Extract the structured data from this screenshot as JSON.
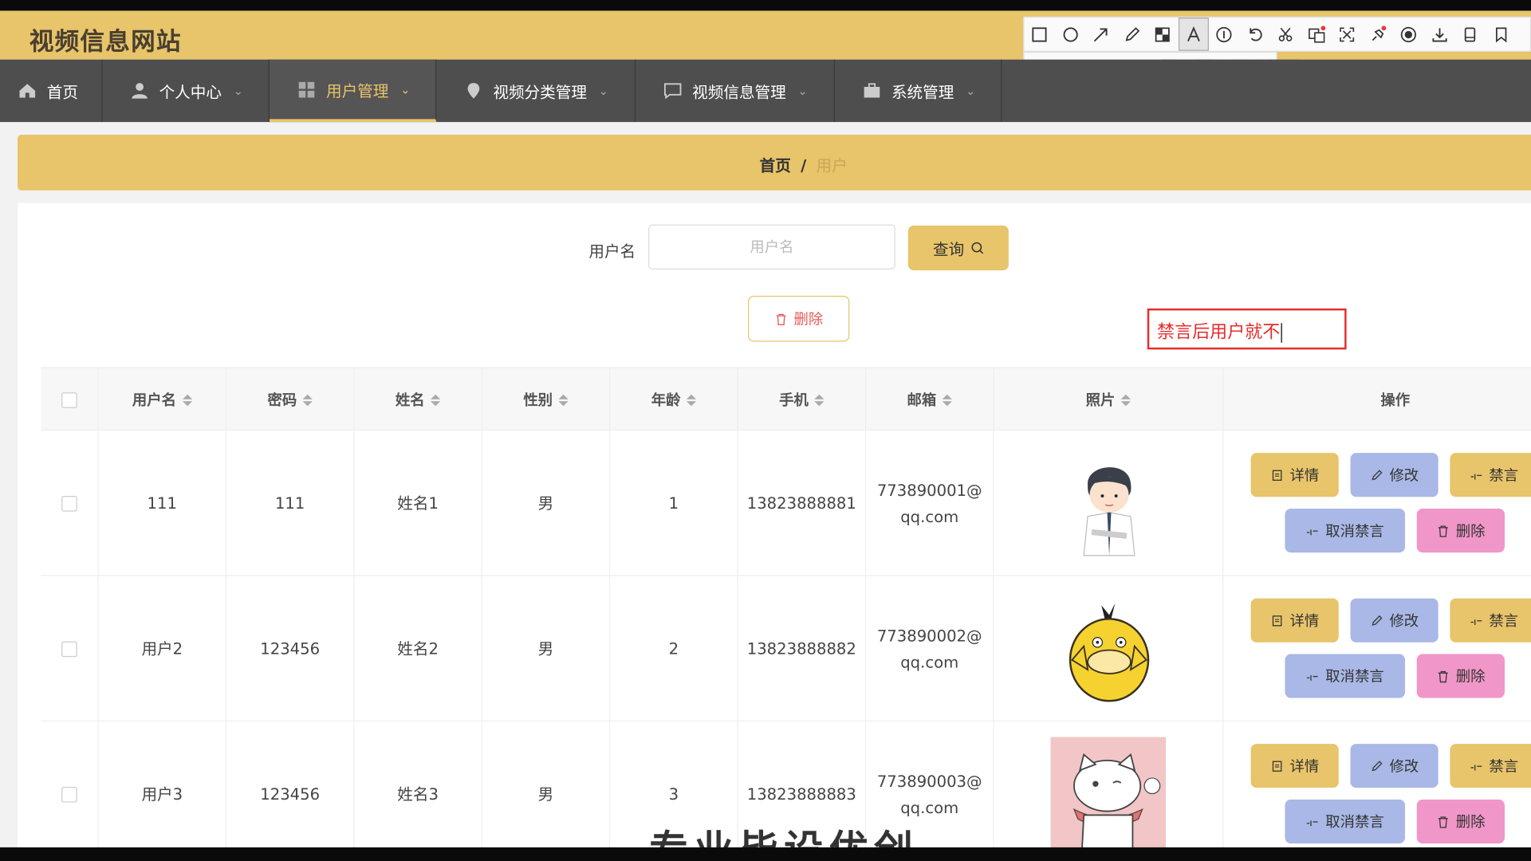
{
  "header": {
    "site_title": "视频信息网站"
  },
  "nav": {
    "items": [
      {
        "label": "首页",
        "icon": "home-icon"
      },
      {
        "label": "个人中心",
        "icon": "user-icon"
      },
      {
        "label": "用户管理",
        "icon": "grid-icon",
        "active": true
      },
      {
        "label": "视频分类管理",
        "icon": "location-pin-icon"
      },
      {
        "label": "视频信息管理",
        "icon": "chat-icon"
      },
      {
        "label": "系统管理",
        "icon": "briefcase-icon"
      }
    ]
  },
  "breadcrumb": {
    "home": "首页",
    "separator": "/",
    "current": "用户"
  },
  "search": {
    "label": "用户名",
    "placeholder": "用户名",
    "button_label": "查询"
  },
  "bulk_delete_label": "删除",
  "annotation": {
    "text": "禁言后用户就不",
    "color": "#e52c2c"
  },
  "table": {
    "columns": [
      "用户名",
      "密码",
      "姓名",
      "性别",
      "年龄",
      "手机",
      "邮箱",
      "照片",
      "操作"
    ],
    "rows": [
      {
        "username": "111",
        "password": "111",
        "name": "姓名1",
        "gender": "男",
        "age": "1",
        "phone": "13823888881",
        "email_line1": "773890001@",
        "email_line2": "qq.com"
      },
      {
        "username": "用户2",
        "password": "123456",
        "name": "姓名2",
        "gender": "男",
        "age": "2",
        "phone": "13823888882",
        "email_line1": "773890002@",
        "email_line2": "qq.com"
      },
      {
        "username": "用户3",
        "password": "123456",
        "name": "姓名3",
        "gender": "男",
        "age": "3",
        "phone": "13823888883",
        "email_line1": "773890003@",
        "email_line2": "qq.com"
      }
    ],
    "actions": {
      "detail": "详情",
      "edit": "修改",
      "ban": "禁言",
      "unban": "取消禁言",
      "delete": "删除"
    }
  },
  "screenshot_tool": {
    "font_size": "12",
    "current_color": "#e83a3a",
    "palette": [
      "#000000",
      "#808080",
      "#800000",
      "#e07030",
      "#208020",
      "#2050c0",
      "#800080",
      "#008080",
      "#ffffff",
      "#c0c0c0",
      "#e03030",
      "#f0e030",
      "#80c020",
      "#3080e0",
      "#e030c0",
      "#30c0c0"
    ]
  },
  "overlay_caption": "专业毕设优创",
  "colors": {
    "accent": "#e8c46a",
    "nav_bg": "#4e4e4e",
    "edit_btn": "#a9b8e6",
    "delete_btn": "#f096c8"
  }
}
